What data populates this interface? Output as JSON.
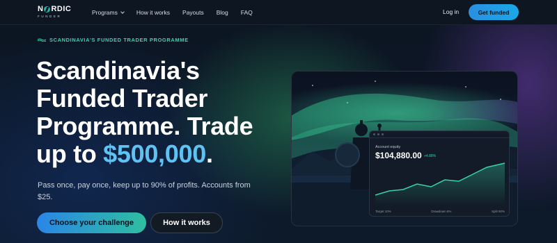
{
  "nav": {
    "logo_main": "NORDIC",
    "logo_sub": "FUNDER",
    "links": [
      {
        "label": "Programs"
      },
      {
        "label": "How it works"
      },
      {
        "label": "Payouts"
      },
      {
        "label": "Blog"
      },
      {
        "label": "FAQ"
      }
    ],
    "login": "Log in",
    "cta": "Get funded"
  },
  "hero": {
    "eyebrow": "SCANDINAVIA'S FUNDED TRADER PROGRAMME",
    "headline_main": "Scandinavia's Funded Trader Programme. Trade up to",
    "headline_amount": "$500,000",
    "headline_end": ".",
    "subtext": "Pass once, pay once, keep up to 90% of profits. Accounts from $25.",
    "primary_button": "Choose your challenge",
    "secondary_button": "How it works"
  },
  "card": {
    "label": "Account equity",
    "value": "$104,880.00",
    "change": "+4.88%",
    "footer": [
      "Target 10%",
      "Drawdown 6%",
      "Split 90%"
    ]
  },
  "colors": {
    "accent_teal": "#39d3a8",
    "accent_blue": "#2a86e6",
    "amount_blue": "#5fc2f2",
    "background": "#0b1420"
  },
  "icons": {
    "nav_dropdown": "chevron-down-icon",
    "eyebrow_mark": "wave-icon"
  }
}
